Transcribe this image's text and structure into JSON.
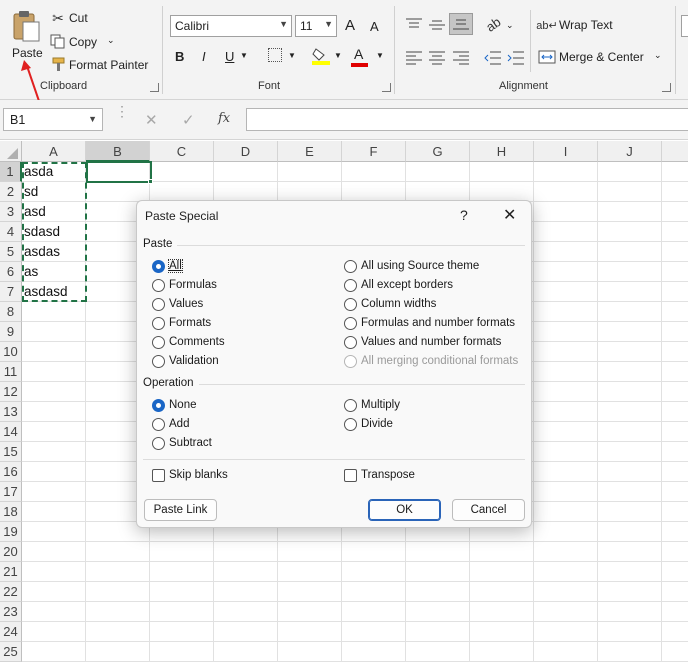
{
  "ribbon": {
    "clipboard": {
      "paste_label": "Paste",
      "cut_label": "Cut",
      "copy_label": "Copy",
      "format_painter_label": "Format Painter",
      "group_label": "Clipboard"
    },
    "font": {
      "font_name": "Calibri",
      "font_size": "11",
      "bold": "B",
      "italic": "I",
      "underline": "U",
      "grow_font": "A",
      "shrink_font": "A",
      "font_color_letter": "A",
      "group_label": "Font",
      "highlight_color": "#ffff00",
      "font_color": "#e00000"
    },
    "alignment": {
      "wrap_text_label": "Wrap Text",
      "merge_center_label": "Merge & Center",
      "group_label": "Alignment"
    }
  },
  "formula_bar": {
    "name_box": "B1",
    "fx_label": "fx",
    "formula_value": ""
  },
  "grid": {
    "columns": [
      "A",
      "B",
      "C",
      "D",
      "E",
      "F",
      "G",
      "H",
      "I",
      "J"
    ],
    "rows": [
      "1",
      "2",
      "3",
      "4",
      "5",
      "6",
      "7",
      "8",
      "9",
      "10",
      "11",
      "12",
      "13",
      "14",
      "15",
      "16",
      "17",
      "18",
      "19",
      "20",
      "21",
      "22",
      "23",
      "24",
      "25"
    ],
    "column_a_values": [
      "asda",
      "sd",
      "asd",
      "sdasd",
      "asdas",
      "as",
      "asdasd"
    ],
    "selected_cell": "B1",
    "selection_color": "#217346"
  },
  "dialog": {
    "title": "Paste Special",
    "help_glyph": "?",
    "paste_section": "Paste",
    "paste_options_left": [
      "All",
      "Formulas",
      "Values",
      "Formats",
      "Comments",
      "Validation"
    ],
    "paste_options_right": [
      "All using Source theme",
      "All except borders",
      "Column widths",
      "Formulas and number formats",
      "Values and number formats",
      "All merging conditional formats"
    ],
    "paste_selected": "All",
    "operation_section": "Operation",
    "operation_options_left": [
      "None",
      "Add",
      "Subtract"
    ],
    "operation_options_right": [
      "Multiply",
      "Divide"
    ],
    "operation_selected": "None",
    "skip_blanks_label": "Skip blanks",
    "transpose_label": "Transpose",
    "paste_link_label": "Paste Link",
    "ok_label": "OK",
    "cancel_label": "Cancel"
  },
  "annotation": {
    "arrow_color": "#e02020"
  }
}
